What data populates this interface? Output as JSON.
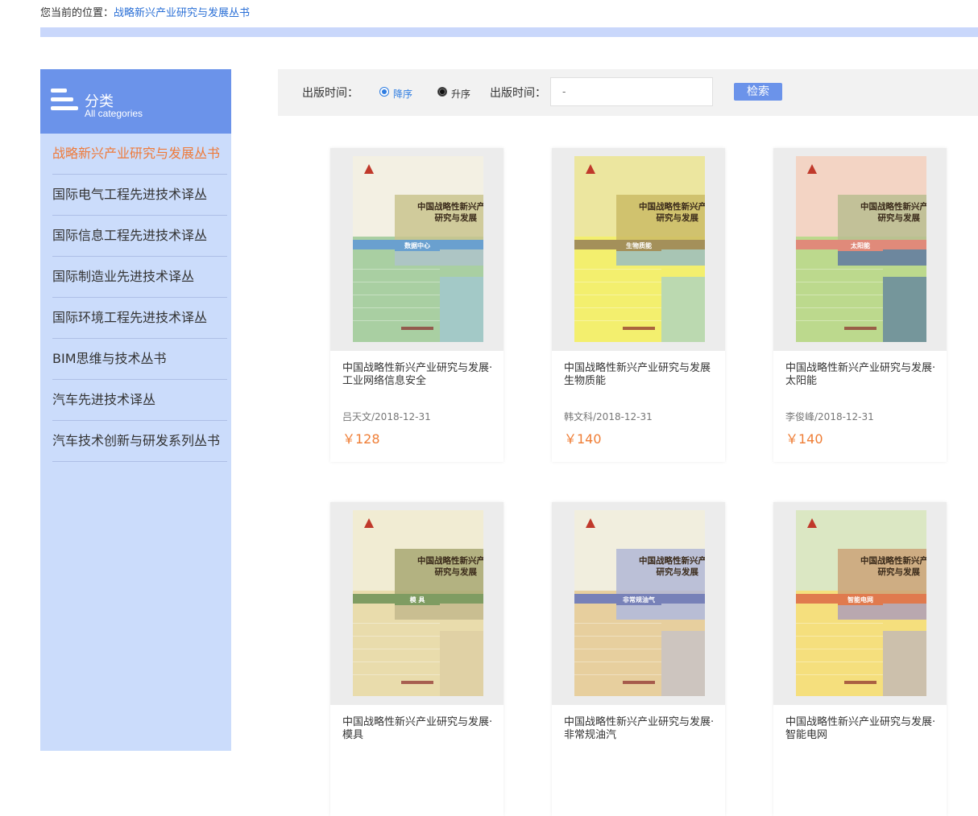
{
  "breadcrumb": {
    "prefix": "您当前的位置：",
    "current": "战略新兴产业研究与发展丛书"
  },
  "sidebar": {
    "title": "分类",
    "subtitle": "All categories",
    "items": [
      {
        "label": "战略新兴产业研究与发展丛书",
        "active": true
      },
      {
        "label": "国际电气工程先进技术译丛"
      },
      {
        "label": "国际信息工程先进技术译丛"
      },
      {
        "label": "国际制造业先进技术译丛"
      },
      {
        "label": "国际环境工程先进技术译丛"
      },
      {
        "label": "BIM思维与技术丛书"
      },
      {
        "label": "汽车先进技术译丛"
      },
      {
        "label": "汽车技术创新与研发系列丛书"
      }
    ]
  },
  "filter": {
    "label_time": "出版时间：",
    "desc_label": "降序",
    "asc_label": "升序",
    "label_range": "出版时间：",
    "range_value": "-",
    "search_label": "检索"
  },
  "books": [
    {
      "title_line1": "中国战略性新兴产业研究与发展·",
      "title_line2": "工业网络信息安全",
      "meta": "吕天文/2018-12-31",
      "price": "￥128",
      "cover_label": "数据中心",
      "cover_heading1": "中国战略性新兴产业",
      "cover_heading2": "研究与发展",
      "colors": {
        "top": "#f3f0e3",
        "mid": "#c9c48e",
        "band": "#6aa0cf",
        "bottom": "#a9cfa2",
        "accent": "#9fc4e6"
      }
    },
    {
      "title_line1": "中国战略性新兴产业研究与发展",
      "title_line2": "生物质能",
      "meta": "韩文科/2018-12-31",
      "price": "￥140",
      "cover_label": "生物质能",
      "cover_heading1": "中国战略性新兴产业",
      "cover_heading2": "研究与发展",
      "colors": {
        "top": "#ece69f",
        "mid": "#cbbb65",
        "band": "#a4905a",
        "bottom": "#f3ef6e",
        "accent": "#8cc6e8"
      }
    },
    {
      "title_line1": "中国战略性新兴产业研究与发展·",
      "title_line2": "太阳能",
      "meta": "李俊峰/2018-12-31",
      "price": "￥140",
      "cover_label": "太阳能",
      "cover_heading1": "中国战略性新兴产业",
      "cover_heading2": "研究与发展",
      "colors": {
        "top": "#f3d4c4",
        "mid": "#b9bd91",
        "band": "#e08a7a",
        "bottom": "#bcd98d",
        "accent": "#3a5fa8"
      }
    },
    {
      "title_line1": "中国战略性新兴产业研究与发展·",
      "title_line2": "模具",
      "meta": "",
      "price": "",
      "cover_label": "模 具",
      "cover_heading1": "中国战略性新兴产业",
      "cover_heading2": "研究与发展",
      "colors": {
        "top": "#f1ecd3",
        "mid": "#a8a872",
        "band": "#7f9c62",
        "bottom": "#e9dcac",
        "accent": "#d9c8a0"
      }
    },
    {
      "title_line1": "中国战略性新兴产业研究与发展·",
      "title_line2": "非常规油汽",
      "meta": "",
      "price": "",
      "cover_label": "非常规油气",
      "cover_heading1": "中国战略性新兴产业",
      "cover_heading2": "研究与发展",
      "colors": {
        "top": "#f1eede",
        "mid": "#b2b7d6",
        "band": "#7781b8",
        "bottom": "#e7cf9e",
        "accent": "#b8bedb"
      }
    },
    {
      "title_line1": "中国战略性新兴产业研究与发展·",
      "title_line2": "智能电网",
      "meta": "",
      "price": "",
      "cover_label": "智能电网",
      "cover_heading1": "中国战略性新兴产业",
      "cover_heading2": "研究与发展",
      "colors": {
        "top": "#dbe7c3",
        "mid": "#cba278",
        "band": "#e07a4e",
        "bottom": "#f5df7d",
        "accent": "#a9a6d4"
      }
    }
  ]
}
